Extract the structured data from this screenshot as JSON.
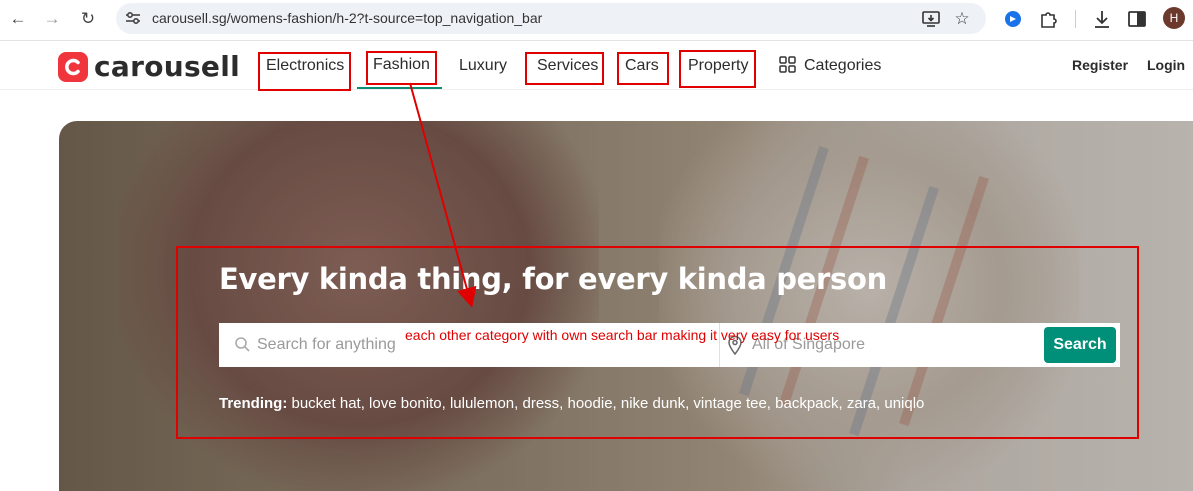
{
  "browser": {
    "url": "carousell.sg/womens-fashion/h-2?t-source=top_navigation_bar",
    "avatar_letter": "H"
  },
  "header": {
    "logo_text": "carousell",
    "nav": [
      "Electronics",
      "Fashion",
      "Luxury",
      "Services",
      "Cars",
      "Property"
    ],
    "categories_label": "Categories",
    "register_label": "Register",
    "login_label": "Login"
  },
  "hero": {
    "headline": "Every kinda thing, for every kinda person",
    "search_placeholder": "Search for anything",
    "location_placeholder": "All of Singapore",
    "search_button": "Search",
    "trending_label": "Trending:",
    "trending_items": "bucket hat, love bonito, lululemon, dress, hoodie, nike dunk, vintage tee, backpack, zara, uniqlo"
  },
  "annotation": {
    "note": "each other category with own search bar making it very easy for users",
    "color": "#e00000"
  },
  "colors": {
    "brand_red": "#f0353c",
    "accent_green": "#008f79"
  }
}
